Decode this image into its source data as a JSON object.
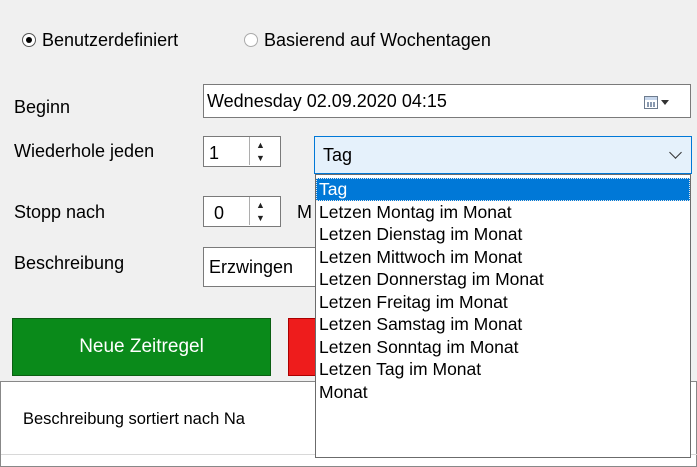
{
  "mode": {
    "custom_label": "Benutzerdefiniert",
    "weekday_label": "Basierend auf Wochentagen",
    "selected": "custom"
  },
  "begin": {
    "label": "Beginn",
    "value": "Wednesday 02.09.2020  04:15",
    "icon": "calendar-icon"
  },
  "repeat": {
    "label": "Wiederhole jeden",
    "interval": "1",
    "unit": "Tag"
  },
  "stop": {
    "label": "Stopp nach",
    "value": "0",
    "unit_partial": "M"
  },
  "description": {
    "label": "Beschreibung",
    "value_partial": "Erzwingen"
  },
  "buttons": {
    "new_rule": "Neue Zeitregel"
  },
  "list": {
    "header_partial": "Beschreibung sortiert nach Na"
  },
  "dropdown": {
    "selected_index": 0,
    "options": [
      "Tag",
      "Letzen Montag im Monat",
      "Letzen Dienstag im Monat",
      "Letzen Mittwoch im Monat",
      "Letzen Donnerstag im Monat",
      "Letzen Freitag im Monat",
      "Letzen Samstag im Monat",
      "Letzen Sonntag im Monat",
      "Letzen Tag im Monat",
      "Monat"
    ]
  },
  "colors": {
    "accent_green": "#0a8a1a",
    "accent_red": "#ee1c1c",
    "selection_blue": "#0078d7"
  }
}
